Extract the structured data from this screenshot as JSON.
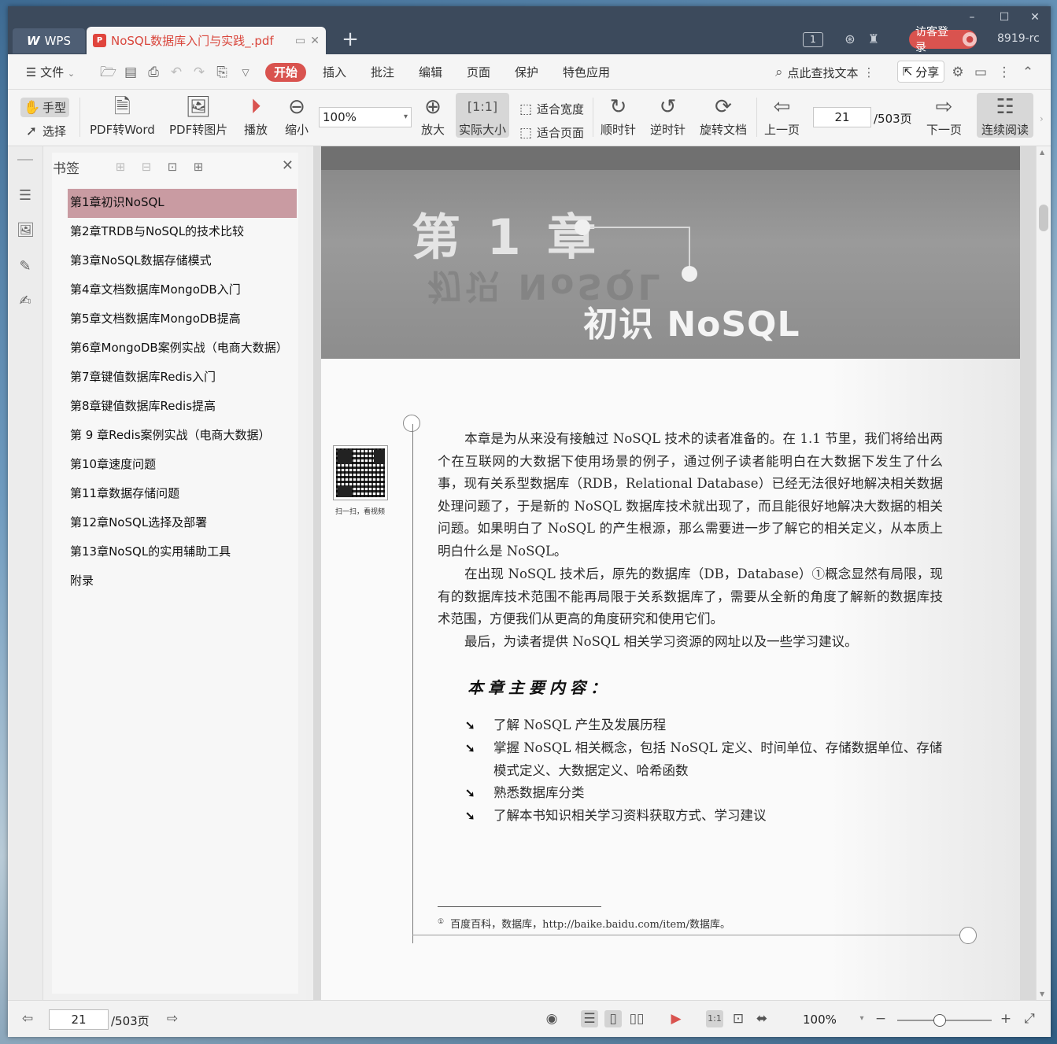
{
  "window": {
    "controls": {
      "minimize": "–",
      "maximize": "☐",
      "close": "✕"
    },
    "tabs": {
      "wps_label": "WPS",
      "doc_label": "NoSQL数据库入门与实践_.pdf"
    },
    "new_tab": "+",
    "window_count": "1",
    "login_label": "访客登录",
    "user_id": "8919-rc"
  },
  "menubar": {
    "file_label": "文件",
    "items": [
      "开始",
      "插入",
      "批注",
      "编辑",
      "页面",
      "保护",
      "特色应用"
    ],
    "active_item": "开始",
    "search_label": "点此查找文本",
    "share_label": "分享"
  },
  "toolbar": {
    "hand_label": "手型",
    "select_label": "选择",
    "pdf_to_word": "PDF转Word",
    "pdf_to_image": "PDF转图片",
    "play_label": "播放",
    "zoom_out_label": "缩小",
    "zoom_value": "100%",
    "zoom_in_label": "放大",
    "actual_size_label": "实际大小",
    "fit_width_label": "适合宽度",
    "fit_page_label": "适合页面",
    "clockwise_label": "顺时针",
    "counter_clockwise_label": "逆时针",
    "rotate_doc_label": "旋转文档",
    "prev_page_label": "上一页",
    "current_page": "21",
    "total_pages": "/503页",
    "next_page_label": "下一页",
    "continuous_label": "连续阅读"
  },
  "bookmarks": {
    "title": "书签",
    "items": [
      "第1章初识NoSQL",
      "第2章TRDB与NoSQL的技术比较",
      "第3章NoSQL数据存储模式",
      "第4章文档数据库MongoDB入门",
      "第5章文档数据库MongoDB提高",
      "第6章MongoDB案例实战（电商大数据）",
      "第7章键值数据库Redis入门",
      "第8章键值数据库Redis提高",
      "第 9 章Redis案例实战（电商大数据）",
      "第10章速度问题",
      "第11章数据存储问题",
      "第12章NoSQL选择及部署",
      "第13章NoSQL的实用辅助工具",
      "附录"
    ],
    "selected_index": 0
  },
  "document": {
    "chapter_number": "第 1 章",
    "chapter_title": "初识 NoSQL",
    "qr_caption": "扫一扫，看视频",
    "paragraphs": [
      "本章是为从来没有接触过 NoSQL 技术的读者准备的。在 1.1 节里，我们将给出两个在互联网的大数据下使用场景的例子，通过例子读者能明白在大数据下发生了什么事，现有关系型数据库（RDB，Relational Database）已经无法很好地解决相关数据处理问题了，于是新的 NoSQL 数据库技术就出现了，而且能很好地解决大数据的相关问题。如果明白了 NoSQL 的产生根源，那么需要进一步了解它的相关定义，从本质上明白什么是 NoSQL。",
      "在出现 NoSQL 技术后，原先的数据库（DB，Database）①概念显然有局限，现有的数据库技术范围不能再局限于关系数据库了，需要从全新的角度了解新的数据库技术范围，方便我们从更高的角度研究和使用它们。",
      "最后，为读者提供 NoSQL 相关学习资源的网址以及一些学习建议。"
    ],
    "section_heading": "本章主要内容：",
    "bullets": [
      "了解 NoSQL 产生及发展历程",
      "掌握 NoSQL 相关概念，包括 NoSQL 定义、时间单位、存储数据单位、存储模式定义、大数据定义、哈希函数",
      "熟悉数据库分类",
      "了解本书知识相关学习资料获取方式、学习建议"
    ],
    "footnote_mark": "①",
    "footnote_text": "百度百科，数据库，http://baike.baidu.com/item/数据库。"
  },
  "statusbar": {
    "current_page": "21",
    "total_pages": "/503页",
    "zoom_value": "100%",
    "zoom_level_fraction": 0.45
  }
}
